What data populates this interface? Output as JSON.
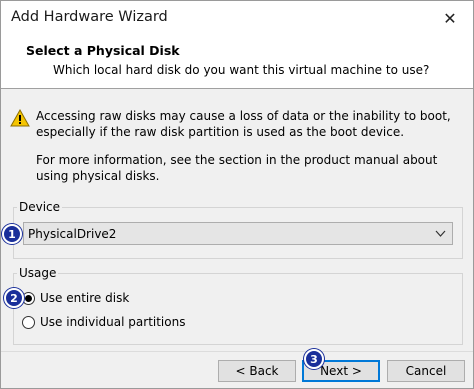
{
  "window": {
    "title": "Add Hardware Wizard",
    "close_icon": "close-icon"
  },
  "header": {
    "title": "Select a Physical Disk",
    "subtitle": "Which local hard disk do you want this virtual machine to use?"
  },
  "warning": {
    "icon": "warning-triangle-icon",
    "text": "Accessing raw disks may cause a loss of data or the inability to boot, especially if the raw disk partition is used as the boot device.",
    "more_info": "For more information, see the section in the product manual about using physical disks."
  },
  "device": {
    "group_label": "Device",
    "selected_value": "PhysicalDrive2",
    "dropdown_icon": "chevron-down-icon"
  },
  "usage": {
    "group_label": "Usage",
    "options": [
      {
        "label": "Use entire disk",
        "selected": true
      },
      {
        "label": "Use individual partitions",
        "selected": false
      }
    ]
  },
  "buttons": {
    "back": "< Back",
    "next": "Next >",
    "cancel": "Cancel"
  },
  "annotations": {
    "badge_1": "1",
    "badge_2": "2",
    "badge_3": "3",
    "badge_color": "#1a2f9a"
  },
  "colors": {
    "accent": "#0078d7",
    "warning_yellow": "#f5c400"
  }
}
